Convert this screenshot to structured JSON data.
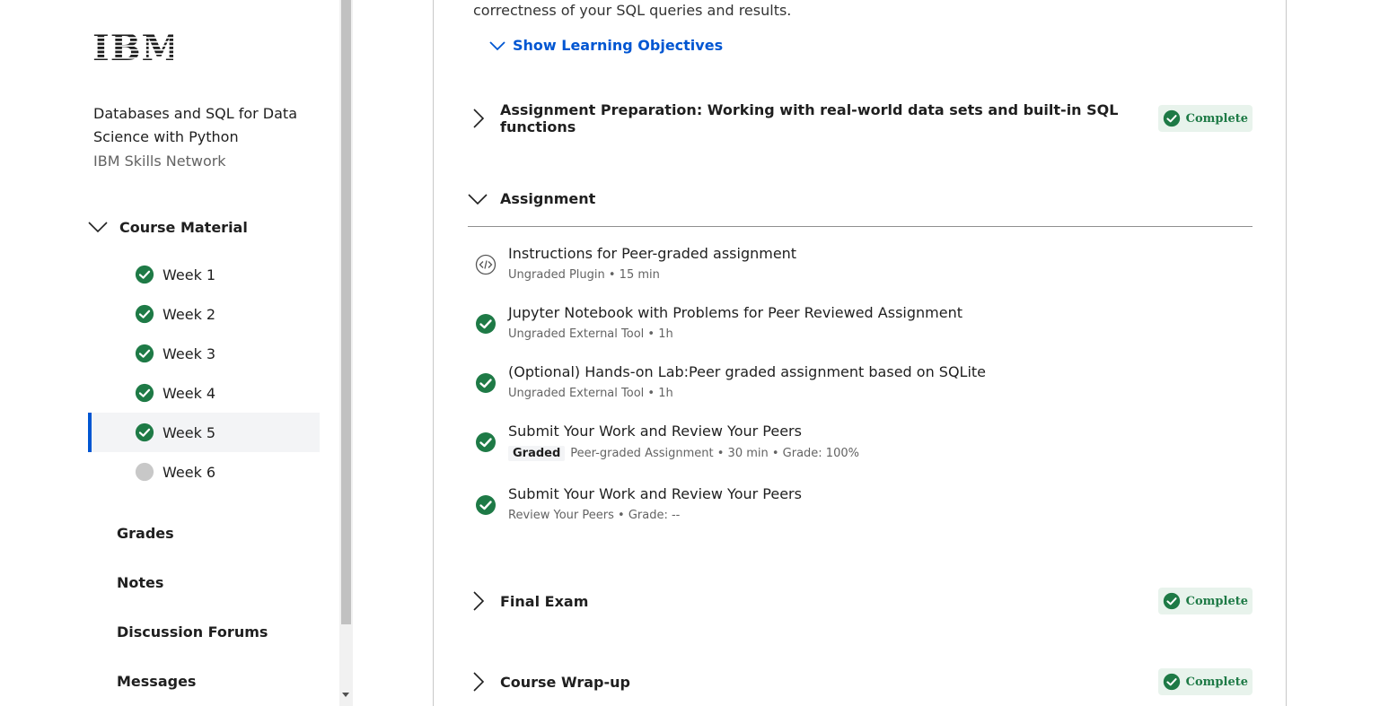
{
  "sidebar": {
    "logo_text": "IBM",
    "course_title": "Databases and SQL for Data Science with Python",
    "course_org": "IBM Skills Network",
    "material_label": "Course Material",
    "weeks": [
      {
        "label": "Week 1",
        "status": "complete"
      },
      {
        "label": "Week 2",
        "status": "complete"
      },
      {
        "label": "Week 3",
        "status": "complete"
      },
      {
        "label": "Week 4",
        "status": "complete"
      },
      {
        "label": "Week 5",
        "status": "complete",
        "active": true
      },
      {
        "label": "Week 6",
        "status": "incomplete"
      }
    ],
    "nav": {
      "grades": "Grades",
      "notes": "Notes",
      "forums": "Discussion Forums",
      "messages": "Messages"
    }
  },
  "main": {
    "description_tail": "correctness of your SQL queries and results.",
    "show_objectives": "Show Learning Objectives",
    "sections": {
      "prep": {
        "title": "Assignment Preparation: Working with real-world data sets and built-in SQL functions",
        "status": "Complete"
      },
      "assignment": {
        "title": "Assignment"
      },
      "final": {
        "title": "Final Exam",
        "status": "Complete"
      },
      "wrapup": {
        "title": "Course Wrap-up",
        "status": "Complete"
      }
    },
    "items": [
      {
        "title": "Instructions for Peer-graded assignment",
        "meta": "Ungraded Plugin • 15 min"
      },
      {
        "title": "Jupyter Notebook with Problems for Peer Reviewed Assignment",
        "meta": "Ungraded External Tool • 1h"
      },
      {
        "title": "(Optional) Hands-on Lab:Peer graded assignment based on SQLite",
        "meta": "Ungraded External Tool • 1h"
      },
      {
        "title": "Submit Your Work and Review Your Peers",
        "tag": "Graded",
        "meta": "Peer-graded Assignment • 30 min • Grade: 100%"
      },
      {
        "title": "Submit Your Work and Review Your Peers",
        "meta": "Review Your Peers • Grade: --"
      }
    ]
  },
  "colors": {
    "accent": "#0056d2",
    "complete_green": "#1e7a46",
    "badge_bg": "#e8f3ec"
  }
}
